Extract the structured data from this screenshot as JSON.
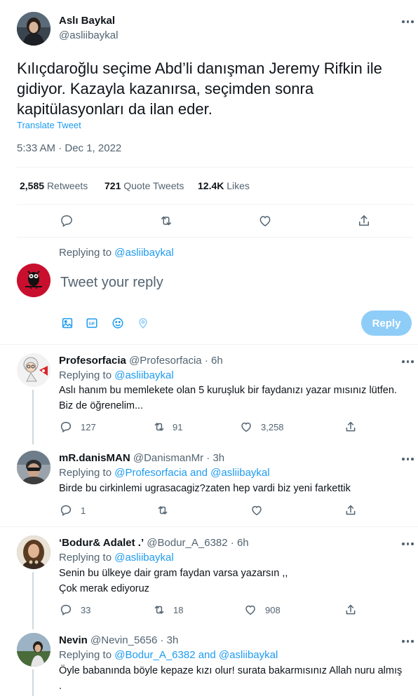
{
  "main_tweet": {
    "author_name": "Aslı Baykal",
    "author_handle": "@asliibaykal",
    "text_line1": "Kılıçdaroğlu seçime Abd’li danışman Jeremy Rifkin ile",
    "text_line2": "gidiyor. Kazayla  kazanırsa, seçimden sonra",
    "text_line3": "kapitülasyonları da ilan eder.",
    "translate_label": "Translate Tweet",
    "timestamp": "5:33 AM · Dec 1, 2022",
    "retweets_count": "2,585",
    "retweets_label": "Retweets",
    "quotes_count": "721",
    "quotes_label": "Quote Tweets",
    "likes_count": "12.4K",
    "likes_label": "Likes"
  },
  "compose": {
    "replying_prefix": "Replying to",
    "replying_handle": "@asliibaykal",
    "placeholder": "Tweet your reply",
    "reply_button": "Reply"
  },
  "replies": [
    {
      "name": "Profesorfacia",
      "handle": "@Profesorfacia",
      "time": "· 6h",
      "replying_prefix": "Replying to",
      "replying_to": "@asliibaykal",
      "line1": "Aslı hanım bu memlekete olan 5 kuruşluk bir faydanızı yazar mısınız lütfen.",
      "line2": "Biz de öğrenelim...",
      "replies": "127",
      "retweets": "91",
      "likes": "3,258"
    },
    {
      "name": "mR.danisMAN",
      "handle": "@DanismanMr",
      "time": "· 3h",
      "replying_prefix": "Replying to",
      "replying_to": "@Profesorfacia and @asliibaykal",
      "line1": "Birde bu cirkinlemi ugrasacagiz?zaten hep vardi biz yeni farkettik",
      "replies": "1",
      "retweets": "",
      "likes": ""
    },
    {
      "name": "‘Bodur& Adalet .’",
      "handle": "@Bodur_A_6382",
      "time": "· 6h",
      "replying_prefix": "Replying to",
      "replying_to": "@asliibaykal",
      "line1": "Senin bu ülkeye dair gram faydan varsa yazarsın ,,",
      "line2": "Çok merak ediyoruz",
      "replies": "33",
      "retweets": "18",
      "likes": "908"
    },
    {
      "name": "Nevin",
      "handle": "@Nevin_5656",
      "time": "· 3h",
      "replying_prefix": "Replying to",
      "replying_to": "@Bodur_A_6382 and @asliibaykal",
      "line1": "Öyle babanında böyle kepaze kızı olur!  surata bakarmısınız Allah nuru almış",
      "line2": "."
    }
  ],
  "colors": {
    "accent": "#1d9bf0",
    "reply_button_disabled": "#8ecdf8",
    "text_primary": "#0f1419",
    "text_secondary": "#536471",
    "divider": "#eff3f4"
  }
}
